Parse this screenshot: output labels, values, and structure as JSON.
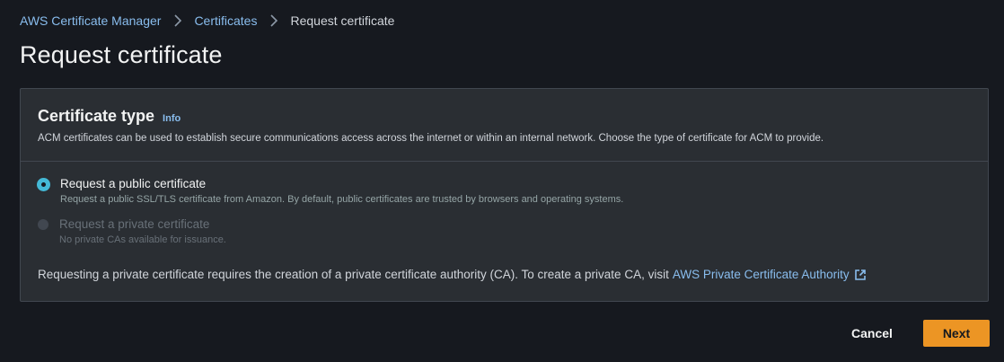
{
  "breadcrumb": {
    "items": [
      {
        "label": "AWS Certificate Manager"
      },
      {
        "label": "Certificates"
      }
    ],
    "current": "Request certificate"
  },
  "page": {
    "title": "Request certificate"
  },
  "certificate_type": {
    "title": "Certificate type",
    "info_label": "Info",
    "description": "ACM certificates can be used to establish secure communications access across the internet or within an internal network. Choose the type of certificate for ACM to provide.",
    "options": [
      {
        "label": "Request a public certificate",
        "description": "Request a public SSL/TLS certificate from Amazon. By default, public certificates are trusted by browsers and operating systems.",
        "selected": true,
        "disabled": false
      },
      {
        "label": "Request a private certificate",
        "description": "No private CAs available for issuance.",
        "selected": false,
        "disabled": true
      }
    ],
    "footnote": "Requesting a private certificate requires the creation of a private certificate authority (CA). To create a private CA, visit",
    "footnote_link": "AWS Private Certificate Authority",
    "footnote_link_icon": "external-link-icon"
  },
  "actions": {
    "cancel_label": "Cancel",
    "next_label": "Next"
  },
  "colors": {
    "background": "#16191f",
    "panel": "#2a2e33",
    "link": "#89bdee",
    "accent_radio": "#44b9d6",
    "primary_button": "#ec9524"
  }
}
